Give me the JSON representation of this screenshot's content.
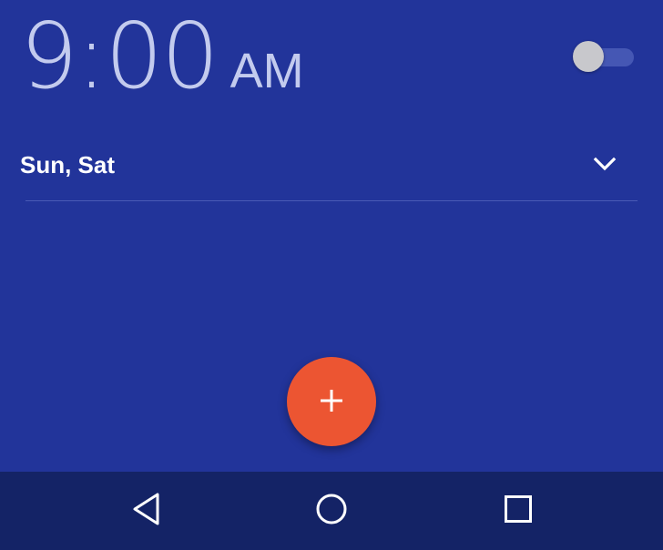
{
  "alarm": {
    "time": "9:00",
    "ampm": "AM",
    "days": "Sun, Sat",
    "enabled": false
  },
  "icons": {
    "expand": "chevron-down-icon",
    "add": "plus-icon",
    "back": "back-triangle-icon",
    "home": "home-circle-icon",
    "recents": "recents-square-icon"
  },
  "colors": {
    "background": "#22349A",
    "navbar": "#142366",
    "fab": "#EC5532",
    "time_text": "#C3CBEE"
  }
}
